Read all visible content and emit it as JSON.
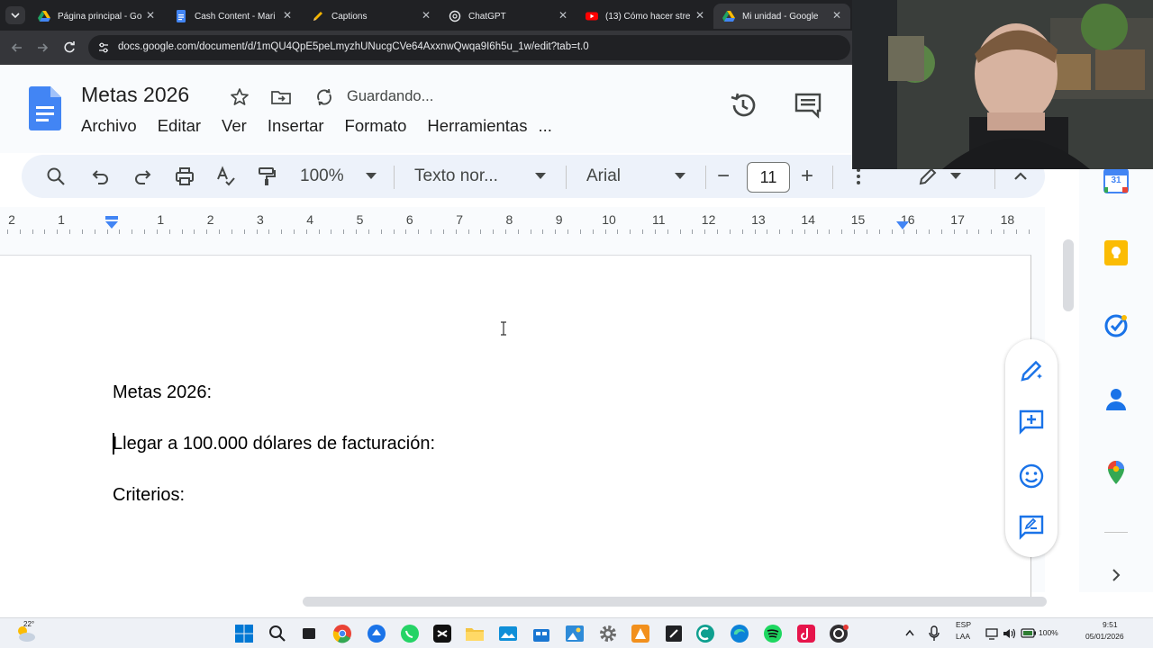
{
  "browser": {
    "tabs": [
      {
        "title": "Página principal - Go",
        "favicon": "google-drive-icon"
      },
      {
        "title": "Cash Content - Mari",
        "favicon": "google-docs-icon"
      },
      {
        "title": "Captions",
        "favicon": "pencil-icon"
      },
      {
        "title": "ChatGPT",
        "favicon": "chatgpt-icon"
      },
      {
        "title": "(13) Cómo hacer stre",
        "favicon": "youtube-icon"
      },
      {
        "title": "Mi unidad - Google",
        "favicon": "google-drive-icon"
      }
    ],
    "url": "docs.google.com/document/d/1mQU4QpE5peLmyzhUNucgCVe64AxxnwQwqa9I6h5u_1w/edit?tab=t.0"
  },
  "docs": {
    "title": "Metas 2026",
    "status": "Guardando...",
    "menu": [
      "Archivo",
      "Editar",
      "Ver",
      "Insertar",
      "Formato",
      "Herramientas",
      "..."
    ],
    "toolbar": {
      "zoom": "100%",
      "style": "Texto nor...",
      "font": "Arial",
      "font_size": "11",
      "minus": "−",
      "plus": "+"
    },
    "ruler": {
      "left_labels": [
        "2",
        "1"
      ],
      "labels": [
        "1",
        "2",
        "3",
        "4",
        "5",
        "6",
        "7",
        "8",
        "9",
        "10",
        "11",
        "12",
        "13",
        "14",
        "15",
        "16",
        "17",
        "18"
      ]
    },
    "content": {
      "paragraphs": [
        "Metas 2026:",
        "Llegar a 100.000 dólares de facturación:",
        "Criterios:"
      ]
    },
    "side_panel": [
      "google-calendar-icon",
      "google-keep-icon",
      "google-tasks-icon",
      "google-contacts-icon",
      "google-maps-icon"
    ],
    "calendar_day": "31"
  },
  "taskbar": {
    "weather_temp": "22°",
    "language": [
      "ESP",
      "LAA"
    ],
    "battery": "100%",
    "time": "9:51",
    "date": "05/01/2026"
  },
  "colors": {
    "docs_blue": "#4285f4",
    "keep_yellow": "#fbbc04",
    "tasks_blue": "#1a73e8",
    "tab_bar": "#202124"
  }
}
